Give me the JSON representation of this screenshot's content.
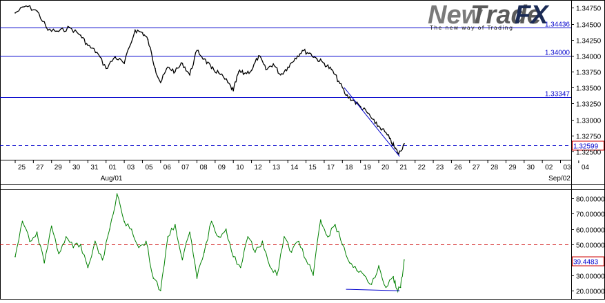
{
  "logo": {
    "part1": "New",
    "part2": "Trade",
    "part3": "FX",
    "tagline": "The new way of Trading"
  },
  "chart_data": [
    {
      "type": "line",
      "title": "",
      "xlabel": "",
      "ylabel": "",
      "grid": false,
      "ylim": [
        1.3238,
        1.3484
      ],
      "y_ticks": [
        "1.34750",
        "1.34500",
        "1.34250",
        "1.34000",
        "1.33750",
        "1.33500",
        "1.33250",
        "1.33000",
        "1.32750",
        "1.32500"
      ],
      "x_tick_labels": [
        "25",
        "27",
        "29",
        "30",
        "31",
        "01",
        "03",
        "05",
        "06",
        "07",
        "08",
        "09",
        "10",
        "12",
        "13",
        "14",
        "15",
        "17",
        "18",
        "19",
        "20",
        "21",
        "22",
        "23",
        "26",
        "27",
        "28",
        "29",
        "30",
        "02",
        "03",
        "04"
      ],
      "month_labels": [
        "Aug/01",
        "Sep/02"
      ],
      "colors": {
        "price": "#000000",
        "levels": "#0000cc",
        "current": "#0000cc"
      },
      "horizontal_levels": [
        {
          "value": 1.34436,
          "label": "1.34436"
        },
        {
          "value": 1.34,
          "label": "1.34000"
        },
        {
          "value": 1.33347,
          "label": "1.33347"
        }
      ],
      "current_price": {
        "value": 1.32599,
        "label": "1.32599"
      },
      "trendline": {
        "from": [
          18.1,
          1.335
        ],
        "to": [
          21.15,
          1.3242
        ]
      },
      "series": [
        {
          "x": [
            0,
            0.6,
            1.2,
            1.8,
            2.4,
            3.0,
            3.6,
            4.0,
            4.5,
            5.0,
            5.5,
            6.0,
            6.6,
            7.0,
            7.3,
            7.7,
            8.0,
            8.4,
            8.8,
            9.2,
            9.6,
            10.0,
            10.4,
            10.8,
            11.2,
            11.7,
            12.0,
            12.3,
            12.6,
            13.0,
            13.4,
            13.8,
            14.2,
            14.6,
            15.0,
            15.4,
            15.8,
            16.2,
            16.6,
            17.0,
            17.4,
            17.8,
            18.2,
            18.6,
            19.0,
            19.4,
            19.8,
            20.2,
            20.6,
            20.9,
            21.1,
            21.4
          ],
          "y": [
            1.3467,
            1.3478,
            1.347,
            1.344,
            1.3438,
            1.3444,
            1.3432,
            1.3416,
            1.3405,
            1.338,
            1.3398,
            1.3388,
            1.344,
            1.3436,
            1.3425,
            1.338,
            1.3358,
            1.3382,
            1.3375,
            1.3388,
            1.337,
            1.3408,
            1.3395,
            1.338,
            1.3373,
            1.3358,
            1.3345,
            1.3375,
            1.3372,
            1.3377,
            1.34,
            1.3378,
            1.3387,
            1.337,
            1.3382,
            1.3396,
            1.3408,
            1.3404,
            1.3395,
            1.3388,
            1.3378,
            1.336,
            1.3338,
            1.333,
            1.332,
            1.331,
            1.3294,
            1.3285,
            1.327,
            1.3255,
            1.3246,
            1.3262
          ]
        }
      ]
    },
    {
      "type": "line",
      "title": "",
      "xlabel": "",
      "ylabel": "",
      "grid": false,
      "ylim": [
        15,
        85
      ],
      "y_ticks": [
        "80.00000",
        "70.00000",
        "60.00000",
        "50.00000",
        "40.00000",
        "30.00000",
        "20.00000"
      ],
      "colors": {
        "indicator": "#008000",
        "midline": "#cc0000"
      },
      "midline": 50,
      "current_value": {
        "value": 39.4483,
        "label": "39.4483"
      },
      "trendline": {
        "from": [
          18.2,
          20.8
        ],
        "to": [
          21.15,
          19.8
        ]
      },
      "series": [
        {
          "x": [
            0,
            0.4,
            0.8,
            1.2,
            1.6,
            2.0,
            2.4,
            2.8,
            3.2,
            3.6,
            4.0,
            4.4,
            4.8,
            5.2,
            5.6,
            6.0,
            6.4,
            6.8,
            7.2,
            7.6,
            8.0,
            8.4,
            8.8,
            9.2,
            9.6,
            10.0,
            10.4,
            10.8,
            11.2,
            11.6,
            12.0,
            12.4,
            12.8,
            13.2,
            13.6,
            14.0,
            14.4,
            14.8,
            15.2,
            15.6,
            16.0,
            16.4,
            16.8,
            17.2,
            17.6,
            18.0,
            18.4,
            18.8,
            19.2,
            19.6,
            20.0,
            20.4,
            20.8,
            21.0,
            21.2,
            21.4
          ],
          "y": [
            42,
            65,
            52,
            58,
            38,
            62,
            44,
            55,
            48,
            50,
            35,
            52,
            40,
            60,
            83,
            65,
            60,
            48,
            52,
            28,
            20,
            55,
            63,
            40,
            58,
            28,
            45,
            65,
            55,
            60,
            42,
            35,
            55,
            45,
            52,
            36,
            30,
            55,
            45,
            52,
            40,
            30,
            66,
            55,
            63,
            50,
            38,
            33,
            30,
            24,
            36,
            22,
            29,
            21,
            22,
            40
          ]
        }
      ]
    }
  ]
}
